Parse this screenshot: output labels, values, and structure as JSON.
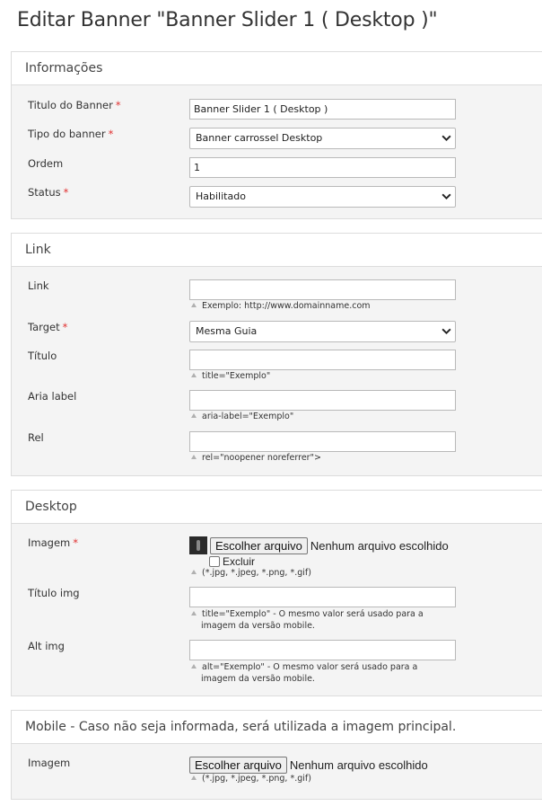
{
  "page": {
    "title": "Editar Banner \"Banner Slider 1 ( Desktop )\""
  },
  "required_mark": "*",
  "informacoes": {
    "heading": "Informações",
    "titulo_label": "Titulo do Banner",
    "titulo_value": "Banner Slider 1 ( Desktop )",
    "tipo_label": "Tipo do banner",
    "tipo_value": "Banner carrossel Desktop",
    "ordem_label": "Ordem",
    "ordem_value": "1",
    "status_label": "Status",
    "status_value": "Habilitado"
  },
  "link": {
    "heading": "Link",
    "link_label": "Link",
    "link_value": "",
    "link_hint": "Exemplo: http://www.domainname.com",
    "target_label": "Target",
    "target_value": "Mesma Guia",
    "titulo_label": "Título",
    "titulo_value": "",
    "titulo_hint": "title=\"Exemplo\"",
    "aria_label": "Aria label",
    "aria_value": "",
    "aria_hint": "aria-label=\"Exemplo\"",
    "rel_label": "Rel",
    "rel_value": "",
    "rel_hint": "rel=\"noopener noreferrer\">"
  },
  "desktop": {
    "heading": "Desktop",
    "imagem_label": "Imagem",
    "file_button": "Escolher arquivo",
    "file_status": "Nenhum arquivo escolhido",
    "excluir_label": "Excluir",
    "file_hint": "(*.jpg, *.jpeg, *.png, *.gif)",
    "titulo_img_label": "Título img",
    "titulo_img_value": "",
    "titulo_img_hint_1": "title=\"Exemplo\" - O mesmo valor será usado para a",
    "titulo_img_hint_2": "imagem da versão mobile.",
    "alt_img_label": "Alt img",
    "alt_img_value": "",
    "alt_img_hint_1": "alt=\"Exemplo\" - O mesmo valor será usado para a",
    "alt_img_hint_2": "imagem da versão mobile."
  },
  "mobile": {
    "heading": "Mobile - Caso não seja informada, será utilizada a imagem principal.",
    "imagem_label": "Imagem",
    "file_button": "Escolher arquivo",
    "file_status": "Nenhum arquivo escolhido",
    "file_hint": "(*.jpg, *.jpeg, *.png, *.gif)"
  },
  "icons": {
    "select_arrow": "chevron-down-icon",
    "hint_marker": "triangle-up-icon",
    "image_thumbnail": "image-thumbnail"
  }
}
